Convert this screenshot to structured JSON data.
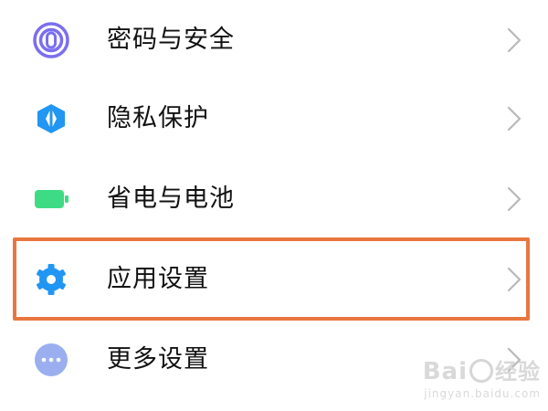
{
  "settings": {
    "items": [
      {
        "label": "密码与安全",
        "icon": "fingerprint-icon",
        "icon_color": "#7a6ef0"
      },
      {
        "label": "隐私保护",
        "icon": "privacy-shield-icon",
        "icon_color": "#2196f3"
      },
      {
        "label": "省电与电池",
        "icon": "battery-icon",
        "icon_color": "#3ddc84"
      },
      {
        "label": "应用设置",
        "icon": "gear-icon",
        "icon_color": "#2196f3",
        "highlighted": true
      },
      {
        "label": "更多设置",
        "icon": "more-dots-icon",
        "icon_color": "#9aaef0"
      }
    ]
  },
  "highlight_color": "#e8773f",
  "watermark": {
    "brand_left": "Bai",
    "brand_right": "经验",
    "url": "jingyan.baidu.com"
  }
}
